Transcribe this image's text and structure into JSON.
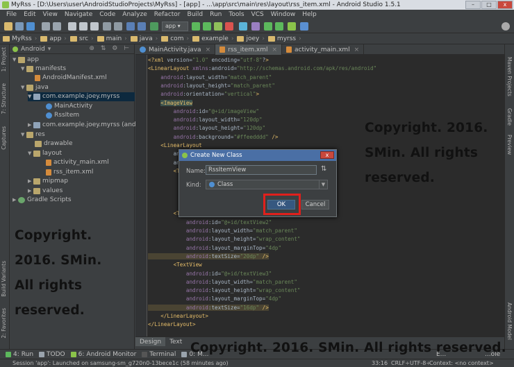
{
  "window": {
    "title": "MyRss - [D:\\Users\\user\\AndroidStudioProjects\\MyRss] - [app] - ...\\app\\src\\main\\res\\layout\\rss_item.xml - Android Studio 1.5.1",
    "minimize": "–",
    "maximize": "□",
    "close": "x"
  },
  "menu": [
    "File",
    "Edit",
    "View",
    "Navigate",
    "Code",
    "Analyze",
    "Refactor",
    "Build",
    "Run",
    "Tools",
    "VCS",
    "Window",
    "Help"
  ],
  "toolbar": {
    "run_config": "app ▾"
  },
  "breadcrumbs": [
    "MyRss",
    "app",
    "src",
    "main",
    "java",
    "com",
    "example",
    "joey",
    "myrss"
  ],
  "project_panel": {
    "view_mode": "Android",
    "tree": [
      {
        "label": "app",
        "icon": "folder",
        "arrow": "▼"
      },
      {
        "label": "manifests",
        "icon": "folder",
        "arrow": "▼"
      },
      {
        "label": "AndroidManifest.xml",
        "icon": "xml",
        "arrow": ""
      },
      {
        "label": "java",
        "icon": "folder",
        "arrow": "▼"
      },
      {
        "label": "com.example.joey.myrss",
        "icon": "pkg",
        "arrow": "▼"
      },
      {
        "label": "MainActivity",
        "icon": "cls",
        "arrow": ""
      },
      {
        "label": "RssItem",
        "icon": "cls",
        "arrow": ""
      },
      {
        "label": "com.example.joey.myrss (androidTe",
        "icon": "pkg",
        "arrow": "▶"
      },
      {
        "label": "res",
        "icon": "folder",
        "arrow": "▼"
      },
      {
        "label": "drawable",
        "icon": "folder",
        "arrow": ""
      },
      {
        "label": "layout",
        "icon": "folder",
        "arrow": "▼"
      },
      {
        "label": "activity_main.xml",
        "icon": "xml",
        "arrow": ""
      },
      {
        "label": "rss_item.xml",
        "icon": "xml",
        "arrow": ""
      },
      {
        "label": "mipmap",
        "icon": "folder",
        "arrow": "▶"
      },
      {
        "label": "values",
        "icon": "folder",
        "arrow": "▶"
      },
      {
        "label": "Gradle Scripts",
        "icon": "gradle",
        "arrow": "▶"
      }
    ]
  },
  "editor_tabs": [
    {
      "label": "MainActivity.java",
      "icon": "cls"
    },
    {
      "label": "rss_item.xml",
      "icon": "xml"
    },
    {
      "label": "activity_main.xml",
      "icon": "xml"
    }
  ],
  "code": [
    "<?xml version=\"1.0\" encoding=\"utf-8\"?>",
    "<LinearLayout xmlns:android=\"http://schemas.android.com/apk/res/android\"",
    "    android:layout_width=\"match_parent\"",
    "    android:layout_height=\"match_parent\"",
    "    android:orientation=\"vertical\">",
    "    <ImageView",
    "        android:id=\"@+id/imageView\"",
    "        android:layout_width=\"120dp\"",
    "        android:layout_height=\"120dp\"",
    "        android:background=\"#ffeedddd\" />",
    "    <LinearLayout",
    "        an",
    "        an",
    "        <Te",
    "",
    "",
    "",
    "",
    "        <TextView",
    "            android:id=\"@+id/textView2\"",
    "            android:layout_width=\"match_parent\"",
    "            android:layout_height=\"wrap_content\"",
    "            android:layout_marginTop=\"4dp\"",
    "            android:textSize=\"20dp\" />",
    "        <TextView",
    "            android:id=\"@+id/textView3\"",
    "            android:layout_width=\"match_parent\"",
    "            android:layout_height=\"wrap_content\"",
    "            android:layout_marginTop=\"4dp\"",
    "            android:textSize=\"16dp\" />",
    "    </LinearLayout>",
    "</LinearLayout>"
  ],
  "watermark": {
    "right": "Copyright. 2016.\nSMin. All rights\nreserved.",
    "left": "Copyright.\n2016. SMin.\nAll rights\nreserved.",
    "bottom": "Copyright. 2016. SMin. All rights reserved."
  },
  "dialog": {
    "title": "Create New Class",
    "close": "x",
    "name_label": "Name:",
    "name_value": "RssItemView",
    "sort_icon": "⇅",
    "kind_label": "Kind:",
    "kind_value": "Class",
    "ok": "OK",
    "cancel": "Cancel"
  },
  "editor_bottom_tabs": [
    "Design",
    "Text"
  ],
  "tool_windows": [
    {
      "num": "4:",
      "label": "Run"
    },
    {
      "num": "",
      "label": "TODO"
    },
    {
      "num": "6:",
      "label": "Android Monitor"
    },
    {
      "num": "",
      "label": "Terminal"
    },
    {
      "num": "0:",
      "label": "M..."
    }
  ],
  "tool_windows_right": [
    "E...",
    "...ole"
  ],
  "left_strip": [
    "1: Project",
    "7: Structure",
    "Captures",
    "Build Variants",
    "2: Favorites"
  ],
  "right_strip": [
    "Maven Projects",
    "Gradle",
    "Preview",
    "Android Model"
  ],
  "status": {
    "message": "Session 'app': Launched on samsung-sm_g720n0-13bece1c (58 minutes ago)",
    "position": "33:16",
    "line_sep": "CRLF÷",
    "encoding": "UTF-8÷",
    "context": "Context: <no context>"
  }
}
